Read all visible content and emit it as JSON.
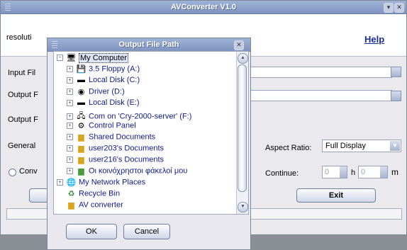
{
  "window": {
    "title": "AVConverter V1.0",
    "help_label": "Help"
  },
  "labels": {
    "resolution": "resoluti",
    "input_file": "Input Fil",
    "output_f1": "Output F",
    "output_f2": "Output F",
    "general": "General",
    "conv": "Conv",
    "aspect_ratio": "Aspect Ratio:",
    "continue": "Continue:",
    "h": "h",
    "m": "m"
  },
  "aspect_ratio_value": "Full Display",
  "continue_h": "0",
  "continue_m": "0",
  "exit_label": "Exit",
  "dialog": {
    "title": "Output File Path",
    "ok_label": "OK",
    "cancel_label": "Cancel",
    "tree": [
      {
        "label": "My Computer",
        "icon": "computer-icon"
      },
      {
        "label": "3.5 Floppy (A:)",
        "icon": "floppy-icon"
      },
      {
        "label": "Local Disk (C:)",
        "icon": "disk-icon"
      },
      {
        "label": "Driver (D:)",
        "icon": "cd-drive-icon"
      },
      {
        "label": "Local Disk (E:)",
        "icon": "disk-icon"
      },
      {
        "label": "Com on 'Cry-2000-server' (F:)",
        "icon": "network-drive-icon"
      },
      {
        "label": "Control Panel",
        "icon": "control-panel-icon"
      },
      {
        "label": "Shared Documents",
        "icon": "folder-icon"
      },
      {
        "label": "user203's Documents",
        "icon": "folder-icon"
      },
      {
        "label": "user216's Documents",
        "icon": "folder-icon"
      },
      {
        "label": "Οι κοινόχρηστοι φάκελοί μου",
        "icon": "shared-folder-icon"
      },
      {
        "label": "My Network Places",
        "icon": "network-places-icon"
      },
      {
        "label": "Recycle Bin",
        "icon": "recycle-bin-icon"
      },
      {
        "label": "AV converter",
        "icon": "folder-icon"
      }
    ]
  },
  "colors": {
    "titlebar": "#8a9ecb",
    "link": "#1a2aa0",
    "tree_text": "#111a8a"
  }
}
